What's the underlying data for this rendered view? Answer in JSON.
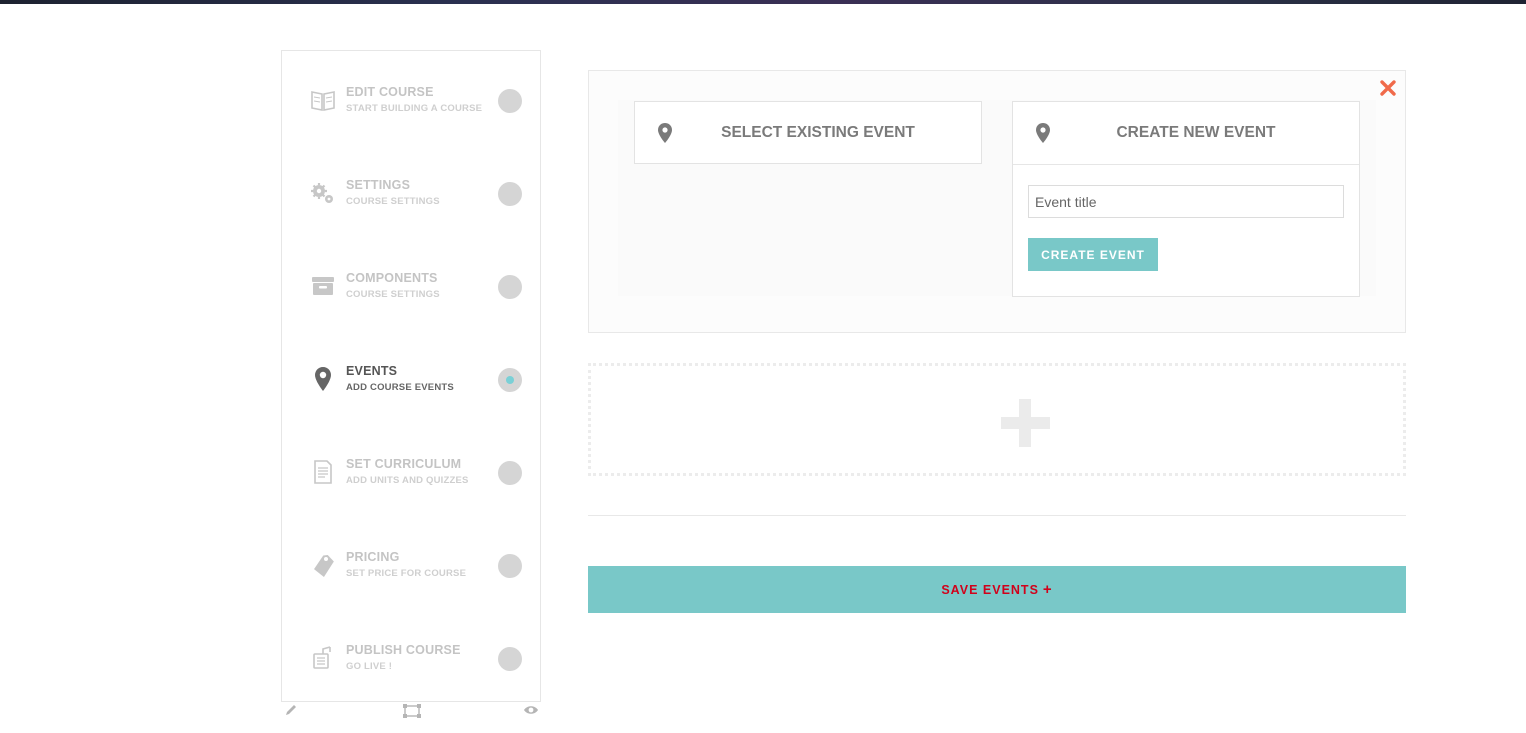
{
  "sidebar": {
    "steps": [
      {
        "title": "EDIT COURSE",
        "subtitle": "START BUILDING A COURSE",
        "icon": "book-icon"
      },
      {
        "title": "SETTINGS",
        "subtitle": "COURSE SETTINGS",
        "icon": "gears-icon"
      },
      {
        "title": "COMPONENTS",
        "subtitle": "COURSE SETTINGS",
        "icon": "archive-box-icon"
      },
      {
        "title": "EVENTS",
        "subtitle": "ADD COURSE EVENTS",
        "icon": "map-pin-icon",
        "active": true
      },
      {
        "title": "SET CURRICULUM",
        "subtitle": "ADD UNITS AND QUIZZES",
        "icon": "document-icon"
      },
      {
        "title": "PRICING",
        "subtitle": "SET PRICE FOR COURSE",
        "icon": "price-tag-icon"
      },
      {
        "title": "PUBLISH COURSE",
        "subtitle": "GO LIVE !",
        "icon": "publish-icon"
      }
    ],
    "tools": [
      "pencil-icon",
      "resize-icon",
      "eye-icon"
    ]
  },
  "events": {
    "select_existing_label": "SELECT EXISTING EVENT",
    "create_new_label": "CREATE NEW EVENT",
    "title_placeholder": "Event title",
    "create_button": "CREATE EVENT",
    "save_button": "SAVE EVENTS",
    "save_button_icon": "+"
  },
  "colors": {
    "accent": "#79c8c8",
    "save_text": "#d0021b",
    "close": "#f06a4a",
    "active_dot": "#7ad0d6"
  }
}
